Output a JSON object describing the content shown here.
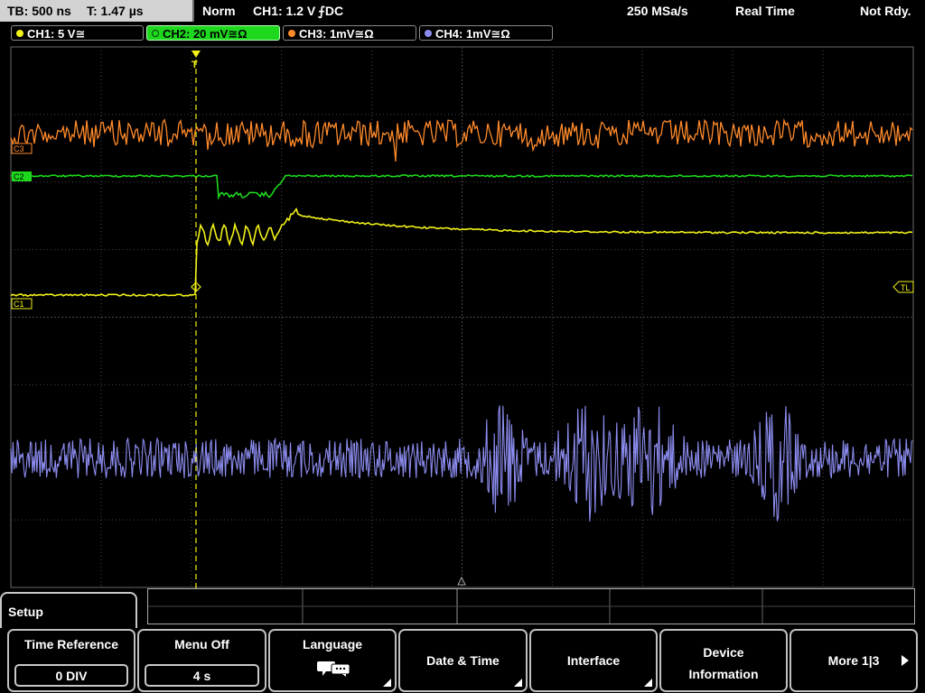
{
  "status": {
    "timebase": "TB: 500 ns",
    "trigger_time": "T: 1.47 µs",
    "mode": "Norm",
    "trigger_source": "CH1: 1.2 V",
    "trigger_slope": "⨍DC",
    "sample_rate": "250 MSa/s",
    "acq_mode": "Real Time",
    "ready_state": "Not Rdy."
  },
  "channels": [
    {
      "label": "CH1: 5 V≅",
      "color": "#f2f219"
    },
    {
      "label": "CH2: 20 mV≅Ω",
      "color": "#1ed81e"
    },
    {
      "label": "CH3: 1mV≅Ω",
      "color": "#ff8a2a"
    },
    {
      "label": "CH4: 1mV≅Ω",
      "color": "#8c8cf0"
    }
  ],
  "markers": {
    "c3": "C3",
    "c2": "C2",
    "c1": "C1",
    "trigger_level": "TL",
    "trigger_pos": "T"
  },
  "menu": {
    "title": "Setup",
    "softkeys": {
      "time_reference": {
        "label": "Time Reference",
        "value": "0 DIV"
      },
      "menu_off": {
        "label": "Menu Off",
        "value": "4 s"
      },
      "language": {
        "label": "Language",
        "icon": "speech-bubble-icon"
      },
      "date_time": {
        "label": "Date & Time"
      },
      "interface": {
        "label": "Interface"
      },
      "device_info": {
        "label_line1": "Device",
        "label_line2": "Information"
      },
      "more": {
        "label": "More 1|3"
      }
    }
  },
  "colors": {
    "grid": "#4a4a4a",
    "trigger_line": "#f2f219"
  }
}
